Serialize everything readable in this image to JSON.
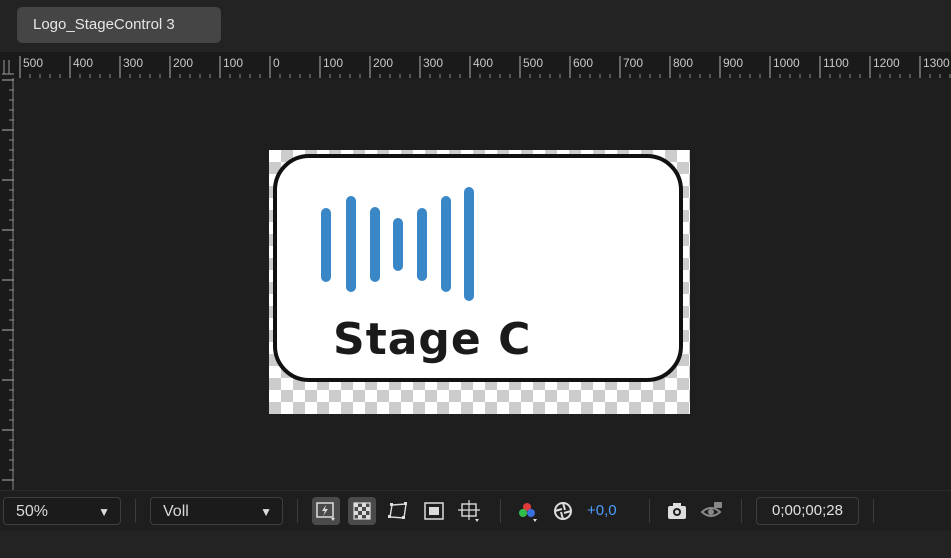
{
  "tab": {
    "title": "Logo_StageControl 3"
  },
  "ruler": {
    "labels": [
      "500",
      "400",
      "300",
      "200",
      "100",
      "0",
      "100",
      "200",
      "300",
      "400",
      "500",
      "600",
      "700",
      "800",
      "900",
      "1000",
      "1100",
      "1200",
      "1300"
    ]
  },
  "composition": {
    "logo_text": "Stage C",
    "logo_bar_color": "#3a87c8",
    "border_color": "#111111"
  },
  "toolbar": {
    "zoom": "50%",
    "resolution": "Voll",
    "exposure": "+0,0",
    "timecode": "0;00;00;28",
    "icons": [
      "fast-preview-icon",
      "transparency-grid-icon",
      "mask-visibility-icon",
      "region-of-interest-icon",
      "guides-icon",
      "color-channels-icon",
      "reset-exposure-icon",
      "snapshot-icon",
      "show-snapshot-icon"
    ]
  }
}
